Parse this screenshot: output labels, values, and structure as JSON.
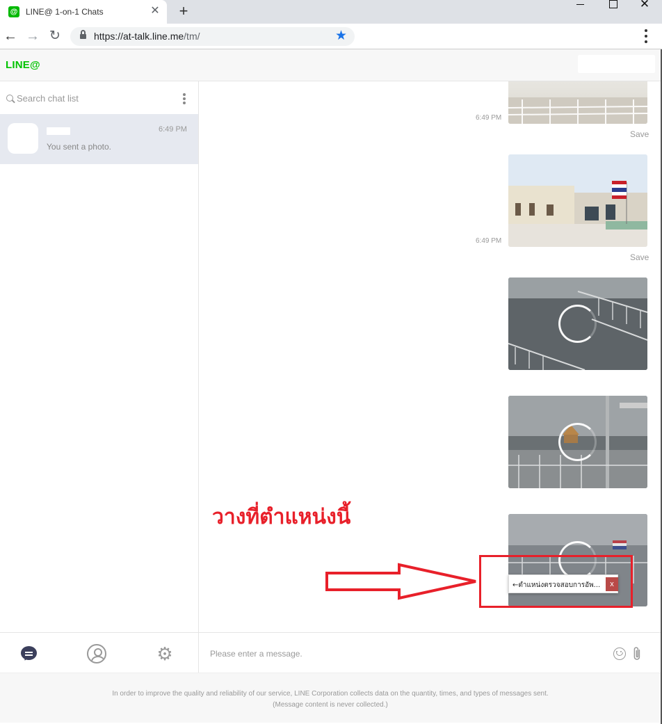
{
  "browser": {
    "tab_title": "LINE@ 1-on-1 Chats",
    "favicon_glyph": "@",
    "tab_close": "✕",
    "new_tab": "+",
    "close_window": "✕",
    "url_host": "https://at-talk.line.me",
    "url_path": "/tm/",
    "back": "←",
    "forward": "→",
    "reload": "↻",
    "star": "★"
  },
  "app": {
    "logo": "LINE@",
    "search_placeholder": "Search chat list",
    "chat_list": [
      {
        "time": "6:49 PM",
        "preview": "You sent a photo."
      }
    ],
    "messages": [
      {
        "time": "6:49 PM",
        "save": "Save"
      },
      {
        "time": "6:49 PM",
        "save": "Save"
      },
      {
        "loading": true
      },
      {
        "loading": true
      },
      {
        "loading": true
      }
    ],
    "composer_placeholder": "Please enter a message.",
    "settings_glyph": "⚙",
    "attach_glyph": "📎",
    "footer_line1": "In order to improve the quality and reliability of our service, LINE Corporation collects data on the quantity, times, and types of messages sent.",
    "footer_line2": "(Message content is never collected.)"
  },
  "overlay": {
    "note": "วางที่ตำแหน่งนี้",
    "tooltip_text": "←ตำแหน่งตรวจสอบการอัพ...",
    "tooltip_close": "x",
    "annotation_color": "#e8202a"
  },
  "colors": {
    "brand": "#00c300",
    "selected_chat": "#e6e9f0",
    "nav_active": "#3b3f5c"
  }
}
